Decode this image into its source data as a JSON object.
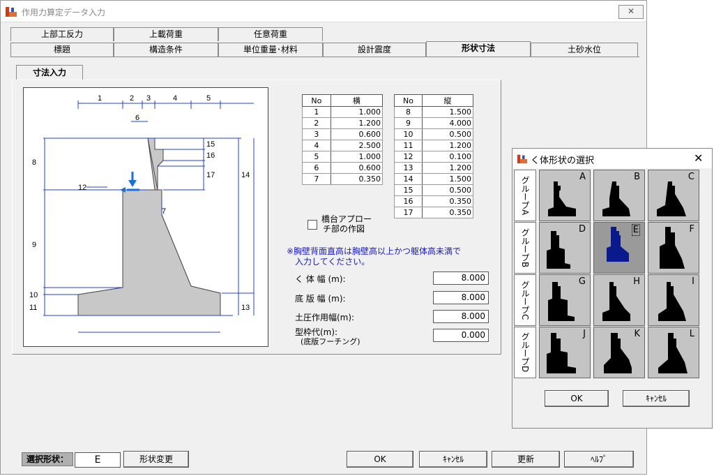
{
  "window": {
    "title": "作用力算定データ入力",
    "close": "✕"
  },
  "tabs": {
    "row1": [
      "上部工反力",
      "上載荷重",
      "任意荷重"
    ],
    "row2": [
      "標題",
      "構造条件",
      "単位重量･材料",
      "設計震度",
      "形状寸法",
      "土砂水位"
    ],
    "active": "形状寸法"
  },
  "subtab": "寸法入力",
  "diagram": {
    "top_labels": [
      "1",
      "2",
      "3",
      "4",
      "5"
    ],
    "labels": {
      "l6": "6",
      "l7": "7",
      "l8": "8",
      "l9": "9",
      "l10": "10",
      "l11": "11",
      "l12": "12",
      "l13": "13",
      "l14": "14",
      "l15": "15",
      "l16": "16",
      "l17": "17"
    }
  },
  "table_yoko": {
    "headers": [
      "No",
      "横"
    ],
    "rows": [
      [
        "1",
        "1.000"
      ],
      [
        "2",
        "1.200"
      ],
      [
        "3",
        "0.600"
      ],
      [
        "4",
        "2.500"
      ],
      [
        "5",
        "1.000"
      ],
      [
        "6",
        "0.600"
      ],
      [
        "7",
        "0.350"
      ]
    ]
  },
  "table_tate": {
    "headers": [
      "No",
      "縦"
    ],
    "rows": [
      [
        "8",
        "1.500"
      ],
      [
        "9",
        "4.000"
      ],
      [
        "10",
        "0.500"
      ],
      [
        "11",
        "1.200"
      ],
      [
        "12",
        "0.100"
      ],
      [
        "13",
        "1.200"
      ],
      [
        "14",
        "1.500"
      ],
      [
        "15",
        "0.500"
      ],
      [
        "16",
        "0.350"
      ],
      [
        "17",
        "0.350"
      ]
    ]
  },
  "approach_checkbox": {
    "line1": "橋台アプロー",
    "line2": "チ部の作図"
  },
  "note": {
    "line1": "※胸壁背面直高は胸壁高以上かつ躯体高未満で",
    "line2": "入力してください。"
  },
  "fields": [
    {
      "label": "く 体 幅 (m):",
      "value": "8.000"
    },
    {
      "label": "底 版 幅 (m):",
      "value": "8.000"
    },
    {
      "label": "土圧作用幅(m):",
      "value": "8.000"
    },
    {
      "label": "型枠代(m):",
      "label2": "(底版フーチング)",
      "value": "0.000"
    }
  ],
  "bottom": {
    "selected_label": "選択形状：",
    "selected_value": "E",
    "change_button": "形状変更",
    "ok": "OK",
    "cancel": "ｷｬﾝｾﾙ",
    "update": "更新",
    "help": "ﾍﾙﾌﾟ"
  },
  "dialog": {
    "title": "く体形状の選択",
    "close": "✕",
    "groups": [
      "グループA",
      "グループB",
      "グループC",
      "グループD"
    ],
    "shapes": [
      "A",
      "B",
      "C",
      "D",
      "E",
      "F",
      "G",
      "H",
      "I",
      "J",
      "K",
      "L"
    ],
    "selected": "E",
    "ok": "OK",
    "cancel": "ｷｬﾝｾﾙ"
  },
  "colors": {
    "accent": "#1a6fd8",
    "selected_shape": "#0a1a8c",
    "note_text": "#1a1ab0",
    "diagram_line": "#2040c0"
  }
}
